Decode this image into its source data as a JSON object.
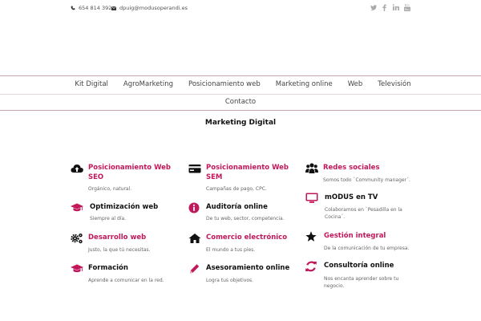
{
  "topbar": {
    "phone": "654 814 392",
    "email": "dpuig@modusoperandi.es",
    "social_icons": [
      "twitter-icon",
      "facebook-icon",
      "linkedin-icon",
      "youtube-icon"
    ]
  },
  "nav": {
    "row1": [
      "Kit Digital",
      "AgroMarketing",
      "Posicionamiento web",
      "Marketing online",
      "Web",
      "Televisión"
    ],
    "row2": [
      "Contacto"
    ]
  },
  "section_title": "Marketing Digital",
  "colors": {
    "accent": "#c2185b",
    "nav_border": "#c9a7b1",
    "text": "#222222"
  },
  "services": [
    {
      "title": "Posicionamiento Web SEO",
      "desc": "Orgánico, natural.",
      "icon": "cloud-upload-icon",
      "pink": true
    },
    {
      "title": "Posicionamiento Web SEM",
      "desc": "Campañas de pago, CPC.",
      "icon": "credit-card-icon",
      "pink": true
    },
    {
      "title": "Redes sociales",
      "desc": "Somos todo `Community manager´.",
      "icon": "users-icon",
      "pink": true
    },
    {
      "title": "Optimización web",
      "desc": "Siempre al día.",
      "icon": "graduation-cap-icon",
      "pink": false
    },
    {
      "title": "Auditoría online",
      "desc": "De tu web, sector, competencia.",
      "icon": "info-icon",
      "pink": false
    },
    {
      "title": "mODUS en TV",
      "desc": "Colaboramos en `Pesadilla en la Cocina´.",
      "icon": "monitor-icon",
      "pink": false
    },
    {
      "title": "Desarrollo web",
      "desc": "Justo, la que tú necesitas.",
      "icon": "cogs-icon",
      "pink": true
    },
    {
      "title": "Comercio electrónico",
      "desc": "El mundo a tus pies.",
      "icon": "home-icon",
      "pink": true
    },
    {
      "title": "Gestión integral",
      "desc": "De la comunicación de tu empresa.",
      "icon": "star-icon",
      "pink": true
    },
    {
      "title": "Formación",
      "desc": "Aprende a comunicar en la red.",
      "icon": "graduation-cap-icon",
      "pink": false
    },
    {
      "title": "Asesoramiento online",
      "desc": "Logra tus objetivos.",
      "icon": "pencil-icon",
      "pink": false
    },
    {
      "title": "Consultoría online",
      "desc": "Nos encanta aprender sobre tu negocio.",
      "icon": "refresh-icon",
      "pink": false
    }
  ]
}
